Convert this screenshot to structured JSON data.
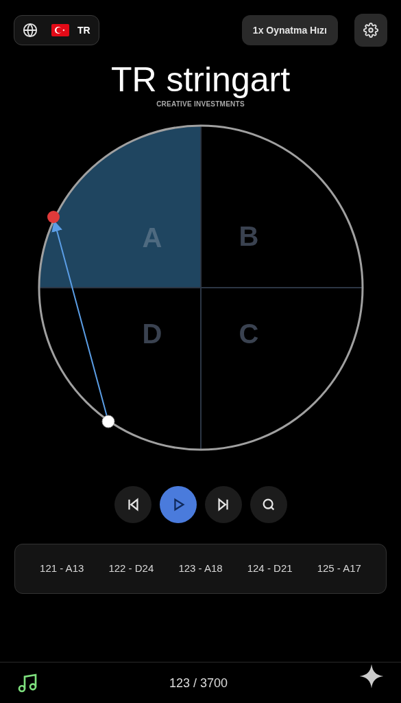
{
  "language": {
    "code": "TR"
  },
  "speed_button": {
    "label": "1x Oynatma Hızı"
  },
  "title": "TR stringart",
  "subtitle": "CREATIVE INVESTMENTS",
  "quadrants": [
    {
      "label": "A",
      "selected": true
    },
    {
      "label": "B",
      "selected": false
    },
    {
      "label": "D",
      "selected": false
    },
    {
      "label": "C",
      "selected": false
    }
  ],
  "sequence": [
    "121 - A13",
    "122 - D24",
    "123 - A18",
    "124 - D21",
    "125 - A17"
  ],
  "progress": "123 / 3700"
}
